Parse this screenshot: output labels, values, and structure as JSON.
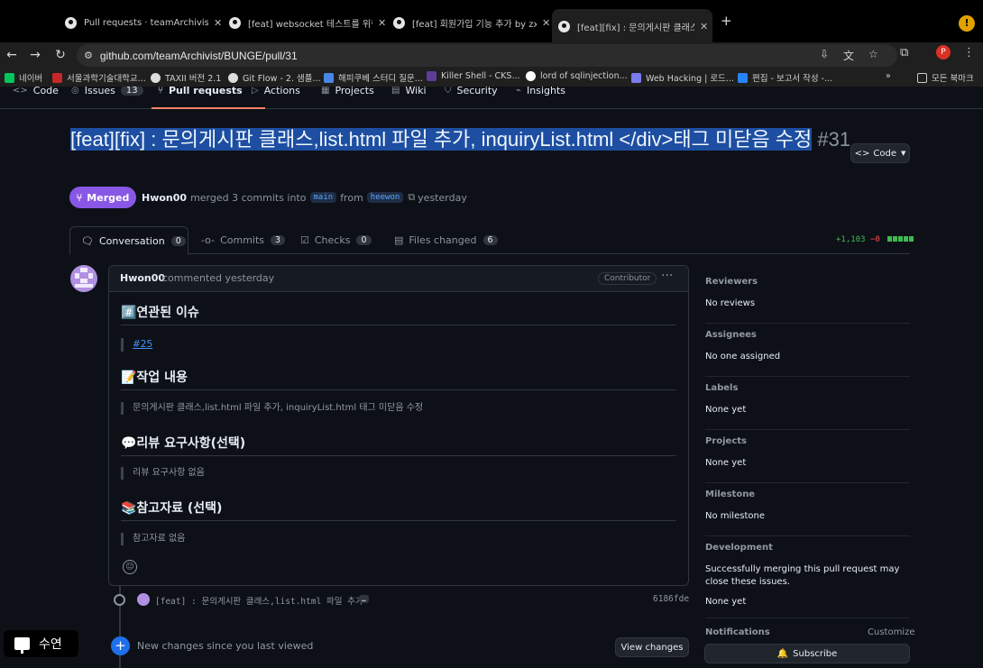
{
  "browser": {
    "tabs": [
      {
        "title": "Pull requests · teamArchivist/"
      },
      {
        "title": "[feat] websocket 테스트를 위한"
      },
      {
        "title": "[feat] 회원가입 기능 추가 by zxc"
      },
      {
        "title": "[feat][fix] : 문의게시판 클래스,li"
      }
    ],
    "url": "github.com/teamArchivist/BUNGE/pull/31",
    "profile_initial": "P",
    "bookmarks": [
      "네이버",
      "서울과학기술대학교...",
      "TAXII 버전 2.1",
      "Git Flow - 2. 샘플...",
      "해피쿠베 스터디 질문...",
      "Killer Shell - CKS...",
      "lord of sqlinjection...",
      "Web Hacking | 로드...",
      "편집 - 보고서 작성 -..."
    ],
    "bookmarks_more": "»",
    "all_bookmarks": "모든 북마크"
  },
  "repo_nav": {
    "items": [
      {
        "label": "Code"
      },
      {
        "label": "Issues",
        "count": "13"
      },
      {
        "label": "Pull requests"
      },
      {
        "label": "Actions"
      },
      {
        "label": "Projects"
      },
      {
        "label": "Wiki"
      },
      {
        "label": "Security"
      },
      {
        "label": "Insights"
      }
    ]
  },
  "pr": {
    "title_selected": "[feat][fix] : 문의게시판 클래스,list.html 파일 추가, inquiryList.html </div>태그 미닫음 수정",
    "number": "#31",
    "code_button": "Code",
    "state": "Merged",
    "author": "Hwon00",
    "merge_text": "merged 3 commits into",
    "base_branch": "main",
    "from_text": "from",
    "head_branch": "heewon",
    "time": "yesterday"
  },
  "tabs": [
    {
      "label": "Conversation",
      "count": "0"
    },
    {
      "label": "Commits",
      "count": "3"
    },
    {
      "label": "Checks",
      "count": "0"
    },
    {
      "label": "Files changed",
      "count": "6"
    }
  ],
  "diffstat": {
    "additions": "+1,103",
    "deletions": "−0"
  },
  "comment": {
    "author": "Hwon00",
    "meta": "commented yesterday",
    "role": "Contributor",
    "sections": [
      {
        "heading": "#️⃣연관된 이슈",
        "body": "#25",
        "is_link": true
      },
      {
        "heading": "📝작업 내용",
        "body": "문의게시판 클래스,list.html 파일 추가, inquiryList.html 태그 미닫음 수정"
      },
      {
        "heading": "💬리뷰 요구사항(선택)",
        "body": "리뷰 요구사항 없음"
      },
      {
        "heading": "📚참고자료 (선택)",
        "body": "참고자료 없음"
      }
    ]
  },
  "timeline": {
    "commit_message": "[feat] : 문의게시판 클래스,list.html 파일 추가",
    "commit_more": "…",
    "commit_sha": "6186fde",
    "new_changes": "New changes since you last viewed",
    "view_changes": "View changes"
  },
  "sidebar": {
    "reviewers": {
      "title": "Reviewers",
      "value": "No reviews"
    },
    "assignees": {
      "title": "Assignees",
      "value": "No one assigned"
    },
    "labels": {
      "title": "Labels",
      "value": "None yet"
    },
    "projects": {
      "title": "Projects",
      "value": "None yet"
    },
    "milestone": {
      "title": "Milestone",
      "value": "No milestone"
    },
    "development": {
      "title": "Development",
      "note": "Successfully merging this pull request may close these issues.",
      "value": "None yet"
    },
    "notifications": {
      "title": "Notifications",
      "customize": "Customize",
      "subscribe": "Subscribe"
    }
  },
  "caption_overlay": "수연",
  "colors": {
    "merged": "#8957e5",
    "accent": "#f78166",
    "link": "#4493f8",
    "additions": "#3fb950",
    "deletions": "#f85149"
  }
}
